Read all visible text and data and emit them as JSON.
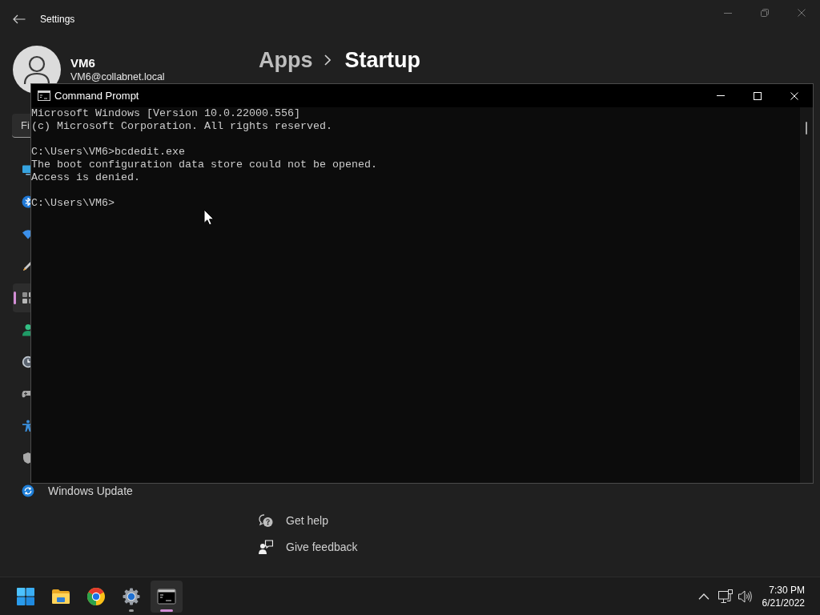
{
  "settings_window": {
    "title": "Settings",
    "profile": {
      "name": "VM6",
      "email": "VM6@collabnet.local"
    },
    "search": {
      "placeholder": "Fi"
    },
    "sidebar": {
      "items": [
        {
          "selected": false
        },
        {
          "selected": false
        },
        {
          "selected": false
        },
        {
          "selected": false
        },
        {
          "selected": true
        },
        {
          "selected": false
        },
        {
          "selected": false
        },
        {
          "selected": false
        },
        {
          "selected": false
        },
        {
          "selected": false
        },
        {
          "label": "Windows Update",
          "selected": false
        }
      ]
    },
    "breadcrumb": [
      "Apps",
      "Startup"
    ],
    "help_links": [
      "Get help",
      "Give feedback"
    ]
  },
  "command_prompt": {
    "title": "Command Prompt",
    "output": [
      [
        "Microsoft Windows [Version 10.0.22000.556]",
        "(c) Microsoft Corporation. All rights reserved."
      ],
      [
        "C:\\Users\\VM6>bcdedit.exe",
        "The boot configuration data store could not be opened.",
        "Access is denied."
      ],
      [
        "C:\\Users\\VM6>"
      ]
    ]
  },
  "taskbar": {
    "apps": [
      {
        "selected": false,
        "running": false
      },
      {
        "selected": false,
        "running": false
      },
      {
        "selected": false,
        "running": false
      },
      {
        "selected": false,
        "running": true
      },
      {
        "selected": true,
        "running": true
      }
    ],
    "clock": {
      "time": "7:30 PM",
      "date": "6/21/2022"
    }
  }
}
